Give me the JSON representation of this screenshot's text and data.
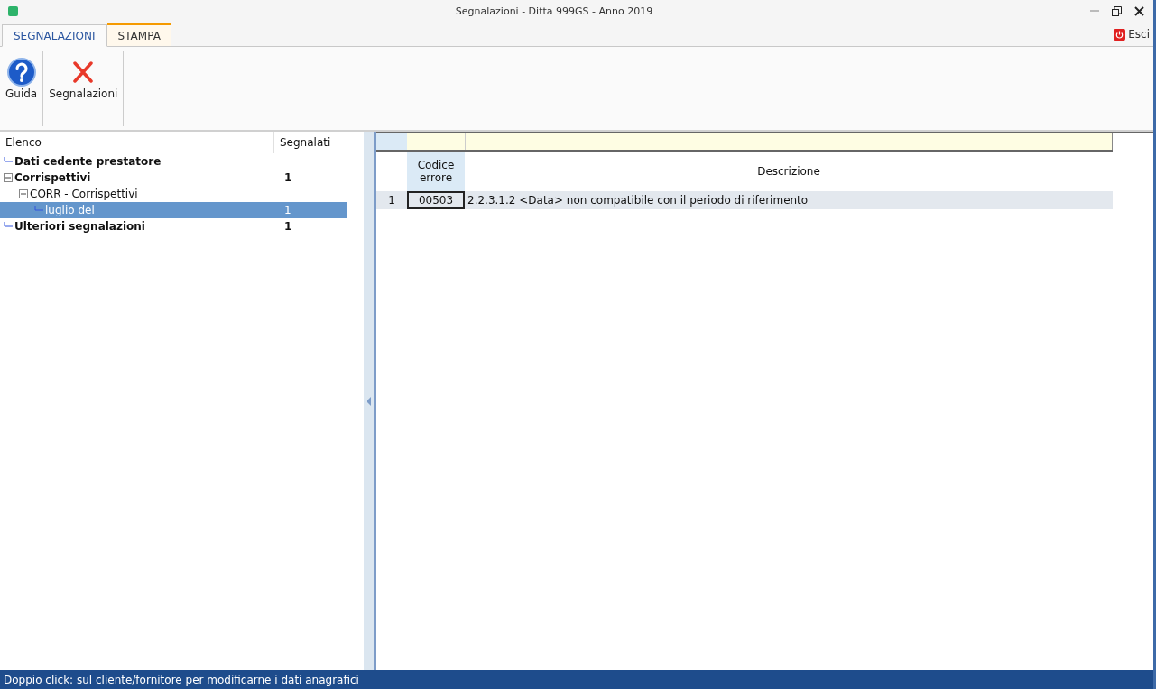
{
  "window": {
    "title": "Segnalazioni - Ditta 999GS - Anno 2019"
  },
  "tabs": [
    {
      "label": "SEGNALAZIONI",
      "selected": true
    },
    {
      "label": "STAMPA",
      "selected": false
    }
  ],
  "exit_button": {
    "label": "Esci"
  },
  "ribbon": [
    {
      "kind": "help",
      "label": "Guida"
    },
    {
      "kind": "delete",
      "label": "Segnalazioni"
    }
  ],
  "tree": {
    "columns": [
      "Elenco",
      "Segnalati"
    ],
    "items": [
      {
        "label": "Dati cedente prestatore",
        "selected": false
      },
      {
        "label": "Corrispettivi",
        "count": "1",
        "selected": false,
        "expanded": true,
        "children": [
          {
            "label": "CORR - Corrispettivi",
            "selected": false,
            "expanded": true,
            "children": [
              {
                "label": "luglio del",
                "count": "1",
                "selected": true
              }
            ]
          }
        ]
      },
      {
        "label": "Ulteriori segnalazioni",
        "count": "1",
        "selected": false
      }
    ]
  },
  "grid": {
    "columns": [
      "Codice errore",
      "Descrizione"
    ],
    "rows": [
      {
        "number": "1",
        "code": "00503",
        "description": "2.2.3.1.2 <Data> non compatibile con il periodo di riferimento",
        "selected": true
      }
    ]
  },
  "status_bar": "Doppio click: sul cliente/fornitore per modificarne i dati anagrafici"
}
